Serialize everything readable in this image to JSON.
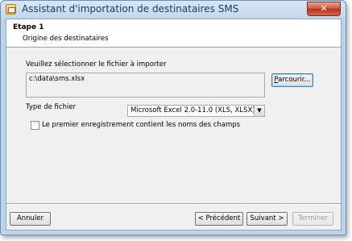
{
  "window": {
    "title": "Assistant d'importation de destinataires SMS"
  },
  "header": {
    "step": "Etape 1",
    "subtitle": "Origine des destinataires"
  },
  "file": {
    "prompt": "Veuillez sélectionner le fichier à importer",
    "path": "c:\\data\\sms.xlsx",
    "browse_prefix": "",
    "browse_mnemonic": "P",
    "browse_rest": "arcourir..."
  },
  "filetype": {
    "label": "Type de fichier",
    "selected": "Microsoft Excel 2.0-11.0 (XLS, XLSX)"
  },
  "header_checkbox": {
    "label": "Le premier enregistrement contient les noms des champs",
    "checked": false
  },
  "footer": {
    "cancel": "Annuler",
    "previous": "< Précédent",
    "next": "Suivant >",
    "finish": "Terminer"
  },
  "icons": {
    "close": "close-icon",
    "app": "app-icon",
    "dropdown": "chevron-down-icon"
  }
}
